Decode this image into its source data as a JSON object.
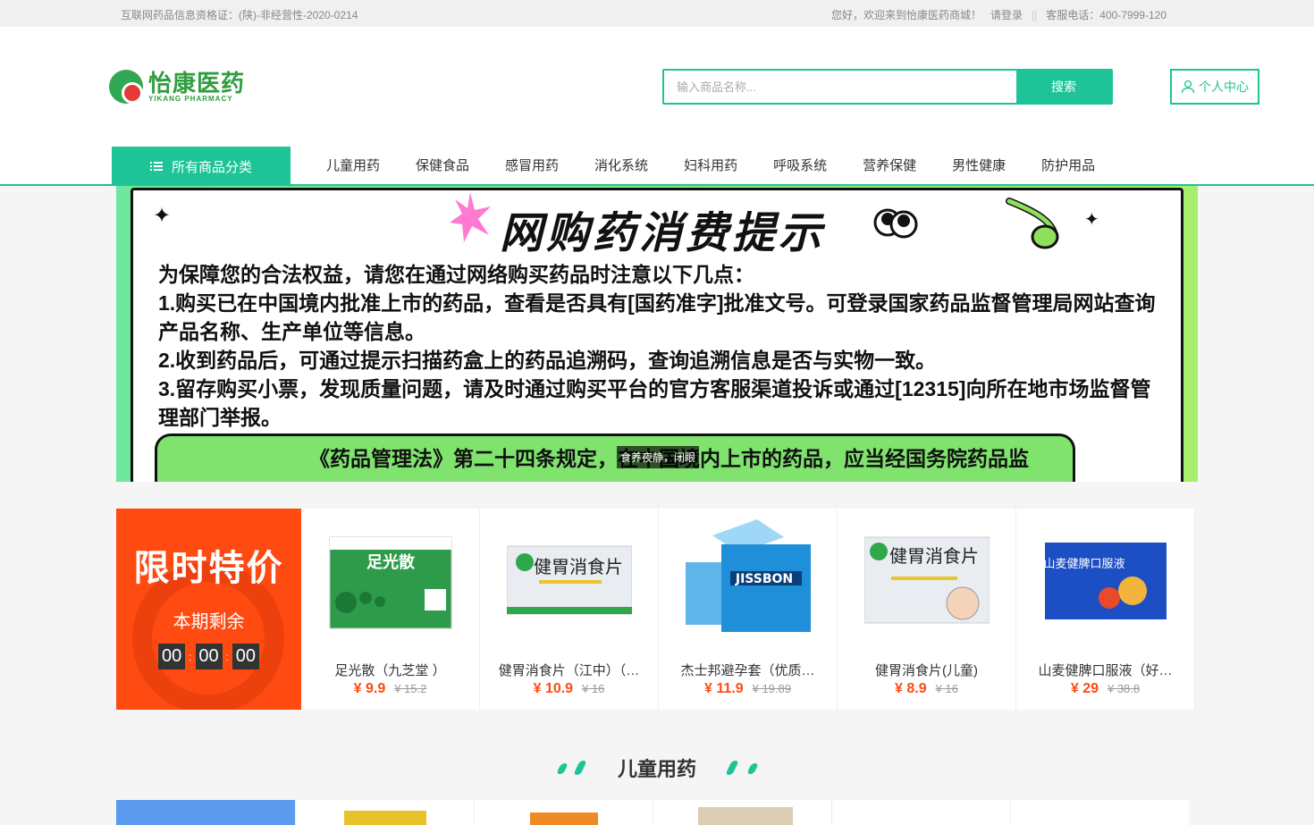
{
  "topbar": {
    "license": "互联网药品信息资格证：(陕)-非经营性-2020-0214",
    "welcome": "您好，欢迎来到怡康医药商城！",
    "login": "请登录",
    "separator": "||",
    "hotline": "客服电话：400-7999-120"
  },
  "logo": {
    "cn": "怡康医药",
    "en": "YIKANG PHARMACY"
  },
  "search": {
    "placeholder": "输入商品名称...",
    "button": "搜索"
  },
  "user_center": {
    "label": "个人中心",
    "icon": "user-icon"
  },
  "nav": {
    "all_categories": "所有商品分类",
    "items": [
      "儿童用药",
      "保健食品",
      "感冒用药",
      "消化系统",
      "妇科用药",
      "呼吸系统",
      "营养保健",
      "男性健康",
      "防护用品"
    ]
  },
  "banner": {
    "title": "网购药消费提示",
    "intro": "为保障您的合法权益，请您在通过网络购买药品时注意以下几点：",
    "p1": "1.购买已在中国境内批准上市的药品，查看是否具有[国药准字]批准文号。可登录国家药品监督管理局网站查询产品名称、生产单位等信息。",
    "p2": "2.收到药品后，可通过提示扫描药盒上的药品追溯码，查询追溯信息是否与实物一致。",
    "p3": "3.留存购买小票，发现质量问题，请及时通过购买平台的官方客服渠道投诉或通过[12315]向所在地市场监督管理部门举报。",
    "tip": "《药品管理法》第二十四条规定，在中国境内上市的药品，应当经国务院药品监",
    "caption": "食养夜静，闭眼"
  },
  "flash_sale": {
    "title": "限时特价",
    "subtitle": "本期剩余",
    "hours": "00",
    "minutes": "00",
    "seconds": "00",
    "colon": ":"
  },
  "products": [
    {
      "name": "足光散（九芝堂 ）",
      "price": "¥ 9.9",
      "orig": "¥ 15.2",
      "box_color": "#2e9b4a",
      "box_label": "足光散"
    },
    {
      "name": "健胃消食片（江中）（…",
      "price": "¥ 10.9",
      "orig": "¥ 16",
      "box_color": "#e9edf2",
      "box_label": "健胃消食片"
    },
    {
      "name": "杰士邦避孕套（优质…",
      "price": "¥ 11.9",
      "orig": "¥ 19.89",
      "box_color": "#1e8fd8",
      "box_label": "JISSBON"
    },
    {
      "name": "健胃消食片(儿童)",
      "price": "¥ 8.9",
      "orig": "¥ 16",
      "box_color": "#e9edf2",
      "box_label": "健胃消食片"
    },
    {
      "name": "山麦健脾口服液（好…",
      "price": "¥ 29",
      "orig": "¥ 38.8",
      "box_color": "#1d4fc4",
      "box_label": "山麦健脾口服液"
    }
  ],
  "section": {
    "title": "儿童用药"
  },
  "colors": {
    "accent": "#1ec497",
    "sale": "#ff4a12"
  }
}
